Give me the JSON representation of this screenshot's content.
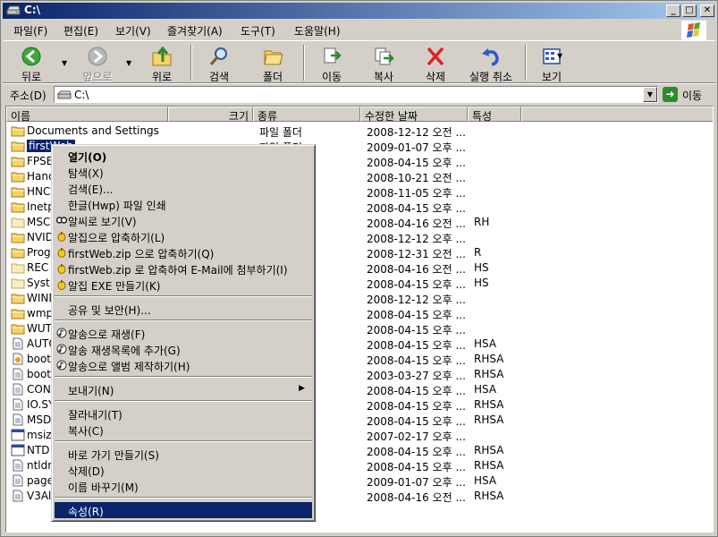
{
  "window": {
    "title": "C:\\"
  },
  "menu": [
    "파일(F)",
    "편집(E)",
    "보기(V)",
    "즐겨찾기(A)",
    "도구(T)",
    "도움말(H)"
  ],
  "toolbar": {
    "back": "뒤로",
    "forward": "앞으로",
    "up": "위로",
    "search": "검색",
    "folders": "폴더",
    "move": "이동",
    "copy": "복사",
    "delete": "삭제",
    "undo": "실행 취소",
    "views": "보기"
  },
  "address": {
    "label": "주소(D)",
    "value": "C:\\",
    "go": "이동"
  },
  "columns": [
    "이름",
    "크기",
    "종류",
    "수정한 날짜",
    "특성"
  ],
  "rows": [
    {
      "name": "Documents and Settings",
      "type": "파일 폴더",
      "date": "2008-12-12 오전 ...",
      "attr": "",
      "icon": "folder"
    },
    {
      "name": "firstWeb",
      "type": "파일 폴더",
      "date": "2009-01-07 오후 ...",
      "attr": "",
      "icon": "folder"
    },
    {
      "name": "FPSE",
      "type": "",
      "date": "2008-04-15 오후 ...",
      "attr": "",
      "icon": "folder"
    },
    {
      "name": "Hanc",
      "type": "",
      "date": "2008-10-21 오전 ...",
      "attr": "",
      "icon": "folder"
    },
    {
      "name": "HNC",
      "type": "",
      "date": "2008-11-05 오후 ...",
      "attr": "",
      "icon": "folder"
    },
    {
      "name": "Inetp",
      "type": "",
      "date": "2008-04-15 오후 ...",
      "attr": "",
      "icon": "folder"
    },
    {
      "name": "MSC",
      "type": "",
      "date": "2008-04-16 오전 ...",
      "attr": "RH",
      "icon": "folder-gray"
    },
    {
      "name": "NVID",
      "type": "",
      "date": "2008-12-12 오후 ...",
      "attr": "",
      "icon": "folder"
    },
    {
      "name": "Prog",
      "type": "",
      "date": "2008-12-31 오전 ...",
      "attr": "R",
      "icon": "folder"
    },
    {
      "name": "REC",
      "type": "",
      "date": "2008-04-16 오전 ...",
      "attr": "HS",
      "icon": "folder-gray"
    },
    {
      "name": "Syst",
      "type": "",
      "date": "2008-04-15 오후 ...",
      "attr": "HS",
      "icon": "folder-gray"
    },
    {
      "name": "WIND",
      "type": "",
      "date": "2008-12-12 오후 ...",
      "attr": "",
      "icon": "folder"
    },
    {
      "name": "wmp",
      "type": "",
      "date": "2008-04-15 오후 ...",
      "attr": "",
      "icon": "folder"
    },
    {
      "name": "WUT",
      "type": "",
      "date": "2008-04-15 오후 ...",
      "attr": "",
      "icon": "folder"
    },
    {
      "name": "AUTO",
      "type": "치 파일",
      "date": "2008-04-15 오후 ...",
      "attr": "HSA",
      "icon": "file"
    },
    {
      "name": "boot.",
      "type": "",
      "date": "2008-04-15 오후 ...",
      "attr": "RHSA",
      "icon": "file-gear"
    },
    {
      "name": "boot",
      "type": "",
      "date": "2003-03-27 오후 ...",
      "attr": "RHSA",
      "icon": "file"
    },
    {
      "name": "CON",
      "type": "",
      "date": "2008-04-15 오후 ...",
      "attr": "HSA",
      "icon": "file"
    },
    {
      "name": "IO.SY",
      "type": "",
      "date": "2008-04-15 오후 ...",
      "attr": "RHSA",
      "icon": "file"
    },
    {
      "name": "MSD",
      "type": "",
      "date": "2008-04-15 오후 ...",
      "attr": "RHSA",
      "icon": "file"
    },
    {
      "name": "msiz",
      "type": "램",
      "date": "2007-02-17 오후 ...",
      "attr": "",
      "icon": "app"
    },
    {
      "name": "NTD",
      "type": "램",
      "date": "2008-04-15 오후 ...",
      "attr": "RHSA",
      "icon": "app"
    },
    {
      "name": "ntldr",
      "type": "",
      "date": "2008-04-15 오후 ...",
      "attr": "RHSA",
      "icon": "file"
    },
    {
      "name": "page",
      "type": "",
      "date": "2009-01-07 오후 ...",
      "attr": "HSA",
      "icon": "file"
    },
    {
      "name": "V3Al",
      "type": "",
      "date": "2008-04-16 오전 ...",
      "attr": "RHSA",
      "icon": "file"
    }
  ],
  "context_menu": [
    {
      "label": "열기(O)",
      "bold": true
    },
    {
      "label": "탐색(X)"
    },
    {
      "label": "검색(E)..."
    },
    {
      "label": "한글(Hwp) 파일 인쇄"
    },
    {
      "label": "알씨로 보기(V)",
      "icon": "alsee"
    },
    {
      "label": "알집으로 압축하기(L)",
      "icon": "alzip"
    },
    {
      "label": "firstWeb.zip 으로 압축하기(Q)",
      "icon": "alzip"
    },
    {
      "label": "firstWeb.zip 로 압축하여 E-Mail에 첨부하기(I)",
      "icon": "alzip"
    },
    {
      "label": "알집 EXE 만들기(K)",
      "icon": "alzip"
    },
    {
      "sep": true
    },
    {
      "label": "공유 및 보안(H)..."
    },
    {
      "sep": true
    },
    {
      "label": "알송으로 재생(F)",
      "icon": "alsong"
    },
    {
      "label": "알송 재생목록에 추가(G)",
      "icon": "alsong"
    },
    {
      "label": "알송으로 앨범 제작하기(H)",
      "icon": "alsong"
    },
    {
      "sep": true
    },
    {
      "label": "보내기(N)",
      "submenu": true
    },
    {
      "sep": true
    },
    {
      "label": "잘라내기(T)"
    },
    {
      "label": "복사(C)"
    },
    {
      "sep": true
    },
    {
      "label": "바로 가기 만들기(S)"
    },
    {
      "label": "삭제(D)"
    },
    {
      "label": "이름 바꾸기(M)"
    },
    {
      "sep": true
    },
    {
      "label": "속성(R)",
      "highlight": true
    }
  ],
  "colors": {
    "title_start": "#0a246a",
    "title_end": "#a6caf0",
    "selection": "#0a246a",
    "folder": "#f5d36b"
  }
}
